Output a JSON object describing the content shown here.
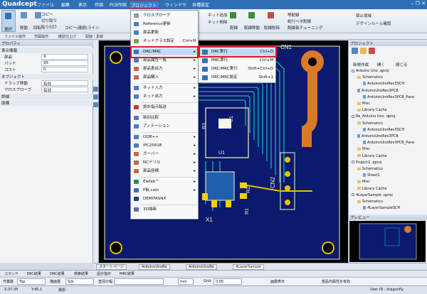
{
  "titlebar": {
    "logo": "Quadcept",
    "menus": [
      "ファイル",
      "編集",
      "表示",
      "作図",
      "PCB作図",
      "プロジェクト",
      "ウィンドウ",
      "各種設定"
    ],
    "window_controls": "‒ ❐ ✕"
  },
  "ribbon": {
    "left_buttons": [
      "選択",
      "移動",
      "回転"
    ],
    "small_buttons": [
      "コピー",
      "切り取り",
      "貼り付け",
      "コピー(連続)",
      "ライン"
    ],
    "right_buttons": [
      "ネット追加",
      "ネット削除",
      "配線",
      "配線移動",
      "配線削除",
      "等配線",
      "蛇行ベタ配線",
      "配線長チューニング",
      "禁止領域",
      "デザインルール確認"
    ]
  },
  "subtabs": [
    "ファイル操作",
    "作図操作",
    "確認仕上げ",
    "配線・素線"
  ],
  "left_panel": {
    "header": "プロパティ",
    "sections": [
      {
        "title": "表示情報",
        "rows": [
          [
            "部品",
            "9"
          ],
          [
            "パッド",
            "95"
          ],
          [
            "コスト",
            "0"
          ]
        ]
      },
      {
        "title": "オブジェクト",
        "rows": [
          [
            "ドラッグ移動",
            "有効"
          ],
          [
            "クロスプローブ",
            "有効"
          ]
        ]
      },
      {
        "title": "詳細",
        "rows": []
      },
      {
        "title": "座標",
        "rows": []
      }
    ]
  },
  "dropdown": {
    "items": [
      {
        "label": "クロスプローブ",
        "arrow": "",
        "color": "#9a9a9a"
      },
      {
        "label": "Reference更新",
        "arrow": "",
        "color": "#4a7bc8"
      },
      {
        "label": "部品更新",
        "arrow": "",
        "color": "#4a7bc8"
      },
      {
        "label": "ネットクラス設定",
        "arrow": "Ctrl+N",
        "color": "#6aa84f"
      },
      {
        "label": "DRC/MRC",
        "arrow": "▸",
        "color": "#3b6fb6"
      },
      {
        "label": "部品属性一覧",
        "arrow": "▸",
        "color": "#4a7bc8"
      },
      {
        "label": "部品表出力",
        "arrow": "▸",
        "color": "#c8664a"
      },
      {
        "label": "部品購入",
        "arrow": "▸",
        "color": "#c8664a"
      },
      {
        "label": "ネット入力",
        "arrow": "▸",
        "color": "#4a7bc8"
      },
      {
        "label": "ネット出力",
        "arrow": "▸",
        "color": "#4a7bc8"
      },
      {
        "label": "設計指示転送",
        "arrow": "",
        "color": "#c83a3a"
      },
      {
        "label": "新旧比較",
        "arrow": "",
        "color": "#4a7bc8"
      },
      {
        "label": "アノテーション",
        "arrow": "",
        "color": "#4a7bc8"
      },
      {
        "label": "ODB++",
        "arrow": "▸",
        "color": "#4a7bc8"
      },
      {
        "label": "IPC2581B",
        "arrow": "▸",
        "color": "#4a7bc8"
      },
      {
        "label": "ガーバー",
        "arrow": "▸",
        "color": "#c8664a"
      },
      {
        "label": "NCドリル",
        "arrow": "▸",
        "color": "#c8664a"
      },
      {
        "label": "部品座標",
        "arrow": "▸",
        "color": "#c8664a"
      },
      {
        "label": "Elefab™",
        "arrow": "▸",
        "color": "#2e8b57"
      },
      {
        "label": "P板.com",
        "arrow": "▸",
        "color": "#3b6fb6"
      },
      {
        "label": "DEMITASNX",
        "arrow": "",
        "color": "#1f3f8a"
      },
      {
        "label": "3D描画",
        "arrow": "",
        "color": "#6a6a9a"
      }
    ]
  },
  "submenu": {
    "items": [
      {
        "label": "DRC実行",
        "shortcut": "Ctrl+D"
      },
      {
        "label": "MRC実行",
        "shortcut": "Ctrl+M"
      },
      {
        "label": "DRC/MRC実行",
        "shortcut": "Shift+Ctrl+D"
      },
      {
        "label": "DRC/MRC設定",
        "shortcut": "Shift+1"
      }
    ]
  },
  "canvas_labels": {
    "cn1": "CN1",
    "cn2": "CN2",
    "u1": "U1",
    "c1": "C1",
    "r3": "R3",
    "r2": "R2",
    "r1": "R1",
    "x1": "X1"
  },
  "right_panel": {
    "header": "プロジェクト",
    "buttons": [
      "新規作成",
      "開く",
      "閉じる"
    ],
    "tree": [
      {
        "level": 0,
        "label": "Arduino Uno .qproj",
        "kind": "proj"
      },
      {
        "level": 1,
        "label": "Schematics",
        "kind": "folder"
      },
      {
        "level": 2,
        "label": "ArduinoUnoRev3SCH",
        "kind": "file"
      },
      {
        "level": 1,
        "label": "ArduinoUnoRev3PCB",
        "kind": "file"
      },
      {
        "level": 2,
        "label": "ArduinoUnoRev3PCB_Pane",
        "kind": "file"
      },
      {
        "level": 1,
        "label": "Misc",
        "kind": "folder"
      },
      {
        "level": 1,
        "label": "Library Cache",
        "kind": "folder"
      },
      {
        "level": 0,
        "label": "Re_Arduino Uno .qproj",
        "kind": "proj"
      },
      {
        "level": 1,
        "label": "Schematics",
        "kind": "folder"
      },
      {
        "level": 2,
        "label": "ArduinoUnoRev3SCH",
        "kind": "file"
      },
      {
        "level": 1,
        "label": "ArduinoUnoRev3PCB",
        "kind": "file"
      },
      {
        "level": 2,
        "label": "ArduinoUnoRev3PCB_Pane",
        "kind": "file"
      },
      {
        "level": 1,
        "label": "Misc",
        "kind": "folder"
      },
      {
        "level": 1,
        "label": "Library Cache",
        "kind": "folder"
      },
      {
        "level": 0,
        "label": "Project1 .qproj",
        "kind": "proj"
      },
      {
        "level": 1,
        "label": "Schematics",
        "kind": "folder"
      },
      {
        "level": 2,
        "label": "Sheet1",
        "kind": "file"
      },
      {
        "level": 1,
        "label": "Misc",
        "kind": "folder"
      },
      {
        "level": 1,
        "label": "Library Cache",
        "kind": "folder"
      },
      {
        "level": 0,
        "label": "4LayerSample .qproj",
        "kind": "proj"
      },
      {
        "level": 1,
        "label": "Schematics",
        "kind": "folder"
      },
      {
        "level": 2,
        "label": "4LayerSampleSCH",
        "kind": "file"
      }
    ],
    "preview_header": "プレビュー"
  },
  "doc_tabs": [
    "スタートページ",
    "ArduinoUnoRe",
    "ArduinoUnoRe",
    "4LayerSample"
  ],
  "output_tabs": [
    "コマンド",
    "ERC結果",
    "DRC結果",
    "検索結果",
    "設計指示",
    "MRC結果"
  ],
  "status_row": {
    "layer_label": "作業層",
    "layer_value": "Top",
    "paint_label": "描画層",
    "paint_value": "Silk",
    "width_label": "直径の幅",
    "unit": "mm",
    "grid_label": "Grid",
    "grid_value": "0.05",
    "display_label": "画層表示",
    "attr_label": "部品内属性を有効"
  },
  "statusbar": {
    "x": "X:37.35",
    "y": "Y:45.1",
    "mode": "選択",
    "user": "User ID : dragonfly"
  }
}
